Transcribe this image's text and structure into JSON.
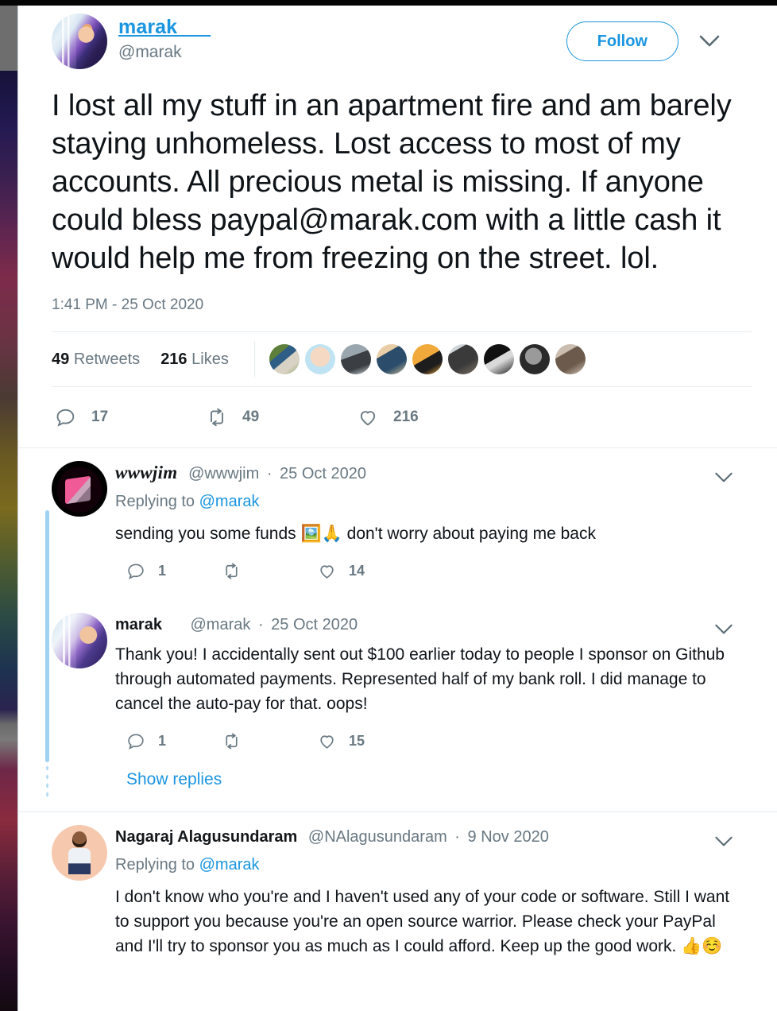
{
  "main_tweet": {
    "display_name": "marak___",
    "handle": "@marak",
    "follow_label": "Follow",
    "text": "I lost all my stuff in an apartment fire and am barely staying unhomeless. Lost access to most of my accounts. All precious metal is missing. If anyone could bless paypal@marak.com with a little cash it would help me from freezing on the street. lol.",
    "timestamp": "1:41 PM - 25 Oct 2020",
    "retweets_count": "49",
    "retweets_label": "Retweets",
    "likes_count": "216",
    "likes_label": "Likes",
    "actions": {
      "reply_count": "17",
      "retweet_count": "49",
      "like_count": "216"
    },
    "facepile_count": 9
  },
  "replies": [
    {
      "display_name": "wwwjim",
      "handle": "@wwwjim",
      "date": "25 Oct 2020",
      "replying_to_label": "Replying to",
      "replying_to_handle": "@marak",
      "text_before": "sending you some funds",
      "emoji": "🖼️🙏",
      "text_after": "don't worry about paying me back",
      "reply_count": "1",
      "retweet_count": "",
      "like_count": "14"
    },
    {
      "display_name": "marak",
      "handle": "@marak",
      "date": "25 Oct 2020",
      "text": "Thank you! I accidentally sent out $100 earlier today to people I sponsor on Github through automated payments. Represented half of my bank roll. I did manage to cancel the auto-pay for that. oops!",
      "reply_count": "1",
      "retweet_count": "",
      "like_count": "15",
      "show_replies_label": "Show replies"
    },
    {
      "display_name": "Nagaraj Alagusundaram",
      "handle": "@NAlagusundaram",
      "date": "9 Nov 2020",
      "replying_to_label": "Replying to",
      "replying_to_handle": "@marak",
      "text": "I don't know who you're and I haven't used any of your code or software. Still I want to support you because you're an open source warrior. Please check your PayPal and I'll try to sponsor you as much as I could afford. Keep up the good work.",
      "emoji": "👍☺️"
    }
  ],
  "colors": {
    "link_blue": "#1b95e0",
    "muted_gray": "#697882",
    "text_black": "#0f1419",
    "divider": "#e6ecf0",
    "thread_line": "#9fd2f0"
  }
}
